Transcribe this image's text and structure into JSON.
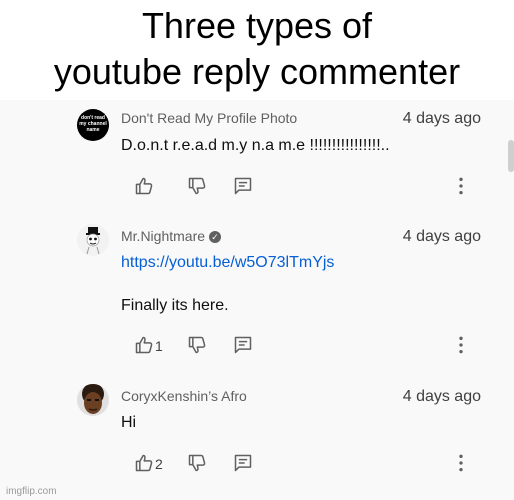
{
  "caption": {
    "line1": "Three types of",
    "line2": "youtube reply commenter"
  },
  "comments": [
    {
      "author": "Don't Read My Profile Photo",
      "date": "4 days ago",
      "text": "D.o.n.t r.e.a.d m.y n.a m.e !!!!!!!!!!!!!!!!..",
      "avatar_text": "don't read my channel name",
      "avatar_color": "#000000"
    },
    {
      "author": "Mr.Nightmare",
      "verified_glyph": "✓",
      "date": "4 days ago",
      "link": "https://youtu.be/w5O73lTmYjs",
      "text": "Finally its here.",
      "likes": "1",
      "avatar_color": "#ffffff"
    },
    {
      "author": "CoryxKenshin’s Afro",
      "date": "4 days ago",
      "text": "Hi",
      "likes": "2",
      "avatar_color": "#3a2418"
    }
  ],
  "watermark": "imgflip.com",
  "icons": [
    "thumbs-up-icon",
    "thumbs-down-icon",
    "reply-icon",
    "more-vertical-icon"
  ],
  "colors": {
    "link": "#065fd4",
    "panel_bg": "#f9f9f9",
    "meta_text": "#606060"
  }
}
